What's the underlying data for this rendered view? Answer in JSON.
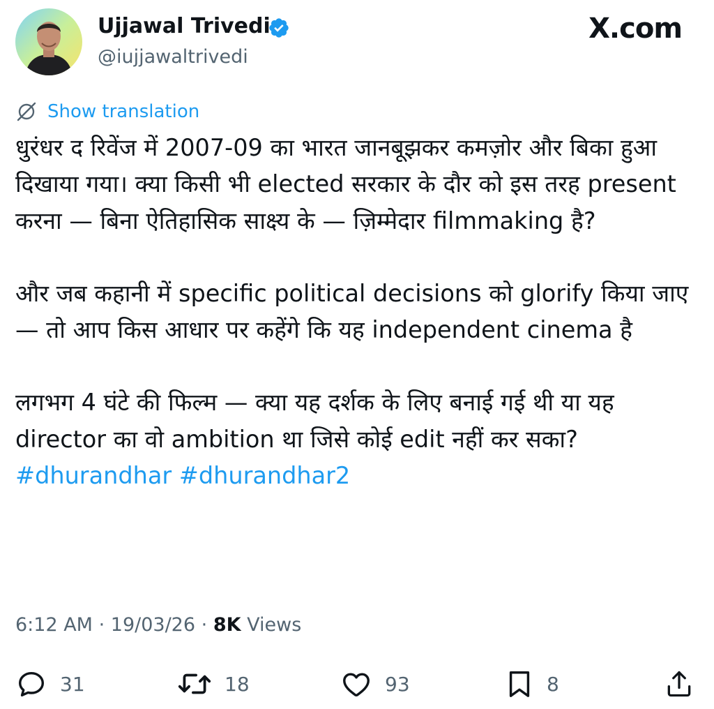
{
  "author": {
    "display_name": "Ujjawal Trivedi",
    "handle": "@iujjawaltrivedi",
    "verified": true
  },
  "brand": "X.com",
  "translate_label": "Show translation",
  "tweet": {
    "paragraph1": "धुरंधर द रिवेंज में 2007-09 का भारत जानबूझकर कमज़ोर और बिका हुआ दिखाया गया। क्या किसी भी elected सरकार के दौर को इस तरह present करना — बिना ऐतिहासिक साक्ष्य के — ज़िम्मेदार filmmaking है?",
    "paragraph2": "और जब कहानी में specific political decisions को glorify किया जाए — तो आप किस आधार पर कहेंगे कि यह independent cinema है",
    "paragraph3": "लगभग 4 घंटे की फिल्म — क्या यह दर्शक के लिए बनाई गई थी या यह director का वो ambition था जिसे कोई edit नहीं कर सका?",
    "hashtags": [
      "#dhurandhar",
      "#dhurandhar2"
    ]
  },
  "meta": {
    "time": "6:12 AM",
    "date": "19/03/26",
    "views_count": "8K",
    "views_label": "Views"
  },
  "actions": {
    "replies": "31",
    "reposts": "18",
    "likes": "93",
    "bookmarks": "8"
  },
  "colors": {
    "accent": "#1d9bf0",
    "text": "#0f1419",
    "muted": "#536471"
  }
}
